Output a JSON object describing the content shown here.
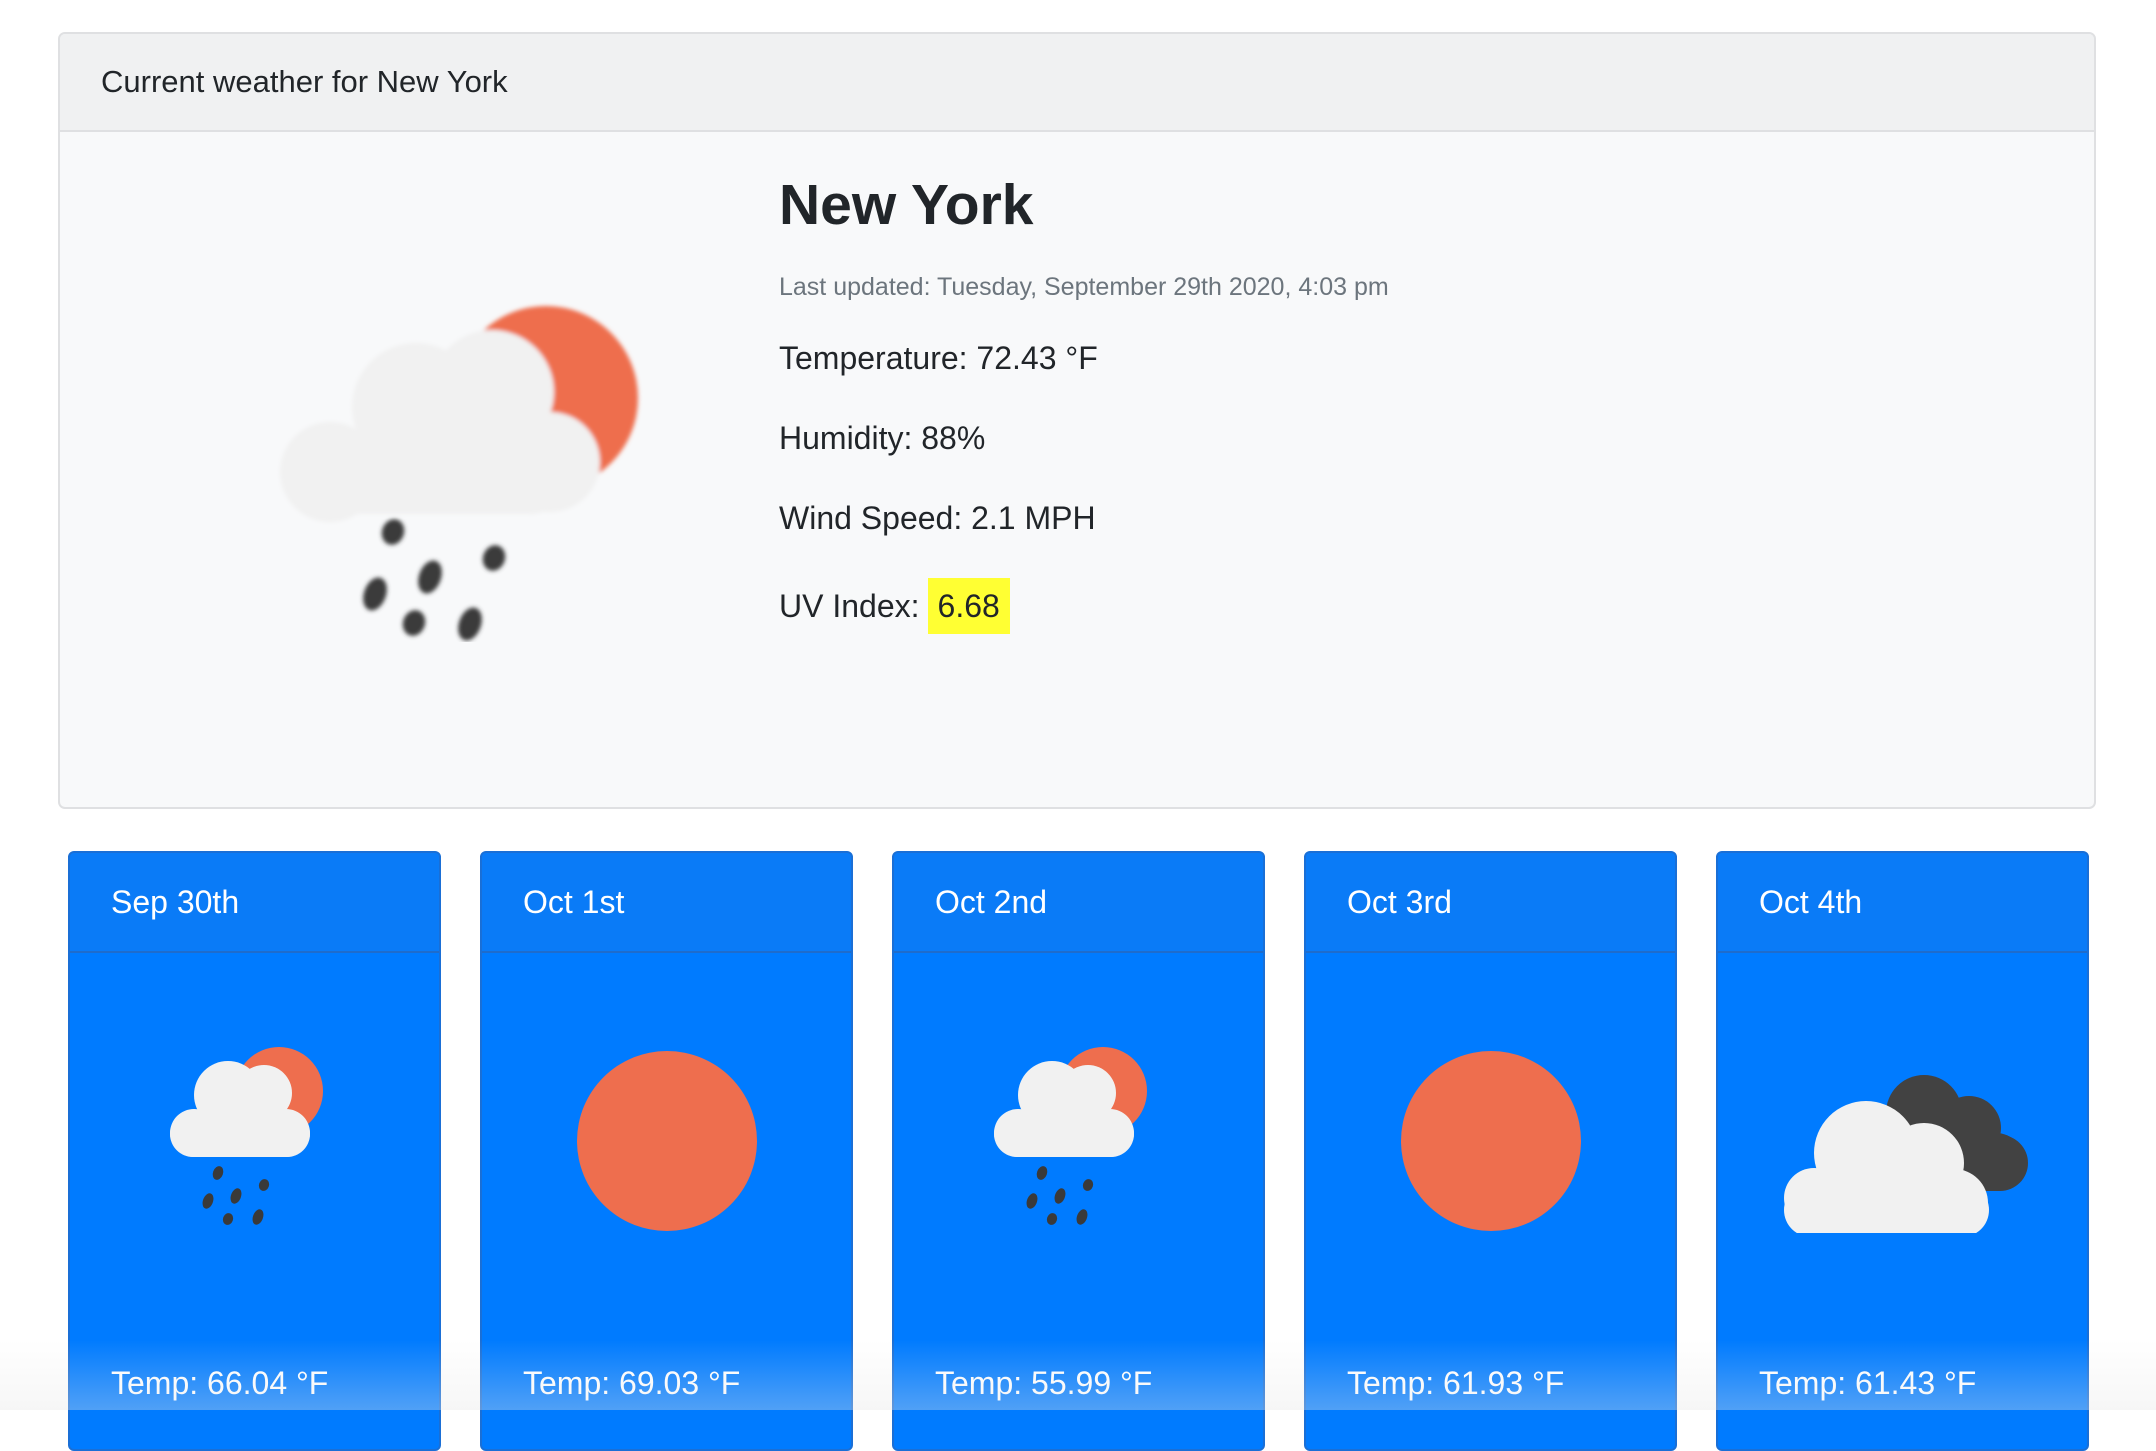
{
  "current": {
    "header": "Current weather for New York",
    "city": "New York",
    "last_updated": "Last updated: Tuesday, September 29th 2020, 4:03 pm",
    "temperature": "Temperature: 72.43 °F",
    "humidity": "Humidity: 88%",
    "wind_speed": "Wind Speed: 2.1 MPH",
    "uv_label": "UV Index:",
    "uv_value": "6.68",
    "icon": "rain-sun-cloud-icon",
    "uv_color": "#ffff33"
  },
  "forecast": [
    {
      "date": "Sep 30th",
      "icon": "rain-sun-cloud-icon",
      "temp": "Temp: 66.04 °F"
    },
    {
      "date": "Oct 1st",
      "icon": "sun-icon",
      "temp": "Temp: 69.03 °F"
    },
    {
      "date": "Oct 2nd",
      "icon": "rain-sun-cloud-icon",
      "temp": "Temp: 55.99 °F"
    },
    {
      "date": "Oct 3rd",
      "icon": "sun-icon",
      "temp": "Temp: 61.93 °F"
    },
    {
      "date": "Oct 4th",
      "icon": "cloudy-icon",
      "temp": "Temp: 61.43 °F"
    }
  ],
  "colors": {
    "card_blue": "#007bff",
    "sun": "#ee6e4e",
    "cloud": "#f1f1f1",
    "dark_cloud": "#424242",
    "rain": "#3a3a3a"
  }
}
